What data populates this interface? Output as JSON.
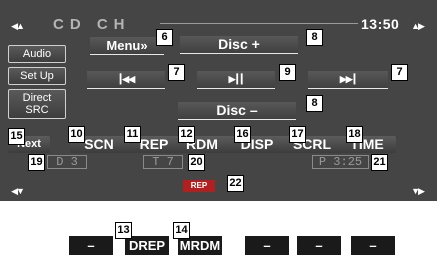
{
  "header": {
    "title": "CD CH",
    "clock": "13:50"
  },
  "corners": {
    "top_left": "◀▲",
    "top_right": "▲▶",
    "mid_left": "◀▼",
    "mid_right": "▼▶"
  },
  "sidebar": {
    "audio": "Audio",
    "setup": "Set Up",
    "direct_line1": "Direct",
    "direct_line2": "SRC"
  },
  "controls": {
    "menu": "Menu»",
    "disc_plus": "Disc +",
    "disc_minus": "Disc –",
    "prev": "┃◀◀",
    "play_pause": "▶┃┃",
    "next": "▶▶┃"
  },
  "functions": {
    "next": "Next",
    "scn": "SCN",
    "rep": "REP",
    "rdm": "RDM",
    "disp": "DISP",
    "scrl": "SCRL",
    "time": "TIME"
  },
  "info": {
    "disc": "D 3",
    "track": "T 7",
    "play_time": "P 3:25"
  },
  "indicator": {
    "rep": "REP"
  },
  "bottom_buttons": [
    "–",
    "DREP",
    "MRDM",
    "–",
    "–",
    "–"
  ],
  "callouts": [
    "6",
    "8",
    "7",
    "9",
    "7",
    "8",
    "15",
    "10",
    "11",
    "12",
    "16",
    "17",
    "18",
    "19",
    "20",
    "21",
    "22",
    "13",
    "14"
  ],
  "colors": {
    "screen_bg": "#454545",
    "rep_indicator": "#b02020",
    "text_dim": "#9a9a9a"
  }
}
